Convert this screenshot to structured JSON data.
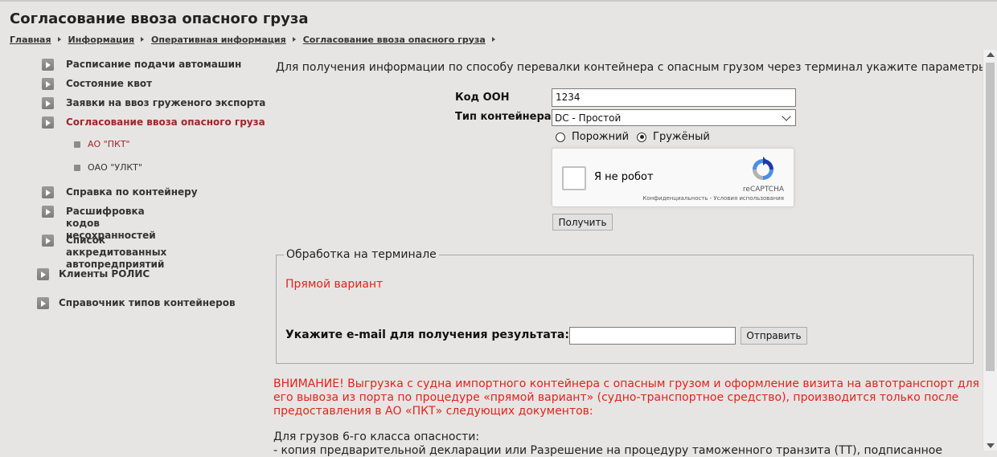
{
  "page": {
    "title": "Согласование ввоза опасного груза"
  },
  "breadcrumb": [
    "Главная",
    "Информация",
    "Оперативная информация",
    "Согласование ввоза опасного груза"
  ],
  "sidebar": {
    "items": [
      {
        "label": "Расписание подачи автомашин"
      },
      {
        "label": "Состояние квот"
      },
      {
        "label": "Заявки на ввоз груженого экспорта"
      },
      {
        "label": "Согласование ввоза опасного груза",
        "active": true
      },
      {
        "label": "Справка по контейнеру"
      },
      {
        "label": "Расшифровка кодов несохранностей"
      },
      {
        "label": "Список аккредитованных автопредприятий"
      },
      {
        "label": "Клиенты РОЛИС"
      },
      {
        "label": "Справочник типов контейнеров"
      }
    ],
    "subitems": [
      {
        "label": "АО \"ПКТ\"",
        "active": true
      },
      {
        "label": "ОАО \"УЛКТ\""
      }
    ]
  },
  "form": {
    "intro": "Для получения информации по способу перевалки контейнера с опасным грузом через терминал укажите параметры",
    "oon_label": "Код ООН",
    "oon_value": "1234",
    "container_type_label": "Тип контейнера",
    "container_type_value": "DC - Простой",
    "radio_empty": "Порожний",
    "radio_loaded": "Гружёный",
    "selected_radio": "loaded",
    "captcha_label": "Я не робот",
    "captcha_brand": "reCAPTCHA",
    "captcha_links": "Конфиденциальность - Условия использования",
    "submit_label": "Получить"
  },
  "processing": {
    "legend": "Обработка на терминале",
    "variant": "Прямой вариант",
    "email_label": "Укажите e-mail для получения результата:",
    "email_value": "",
    "send_label": "Отправить"
  },
  "notice": {
    "warning": "ВНИМАНИЕ! Выгрузка с судна импортного контейнера с опасным грузом и оформление визита на автотранспорт для его вывоза из порта по процедуре «прямой вариант» (судно-транспортное средство), производится только после предоставления в АО «ПКТ» следующих документов:",
    "class_title": "Для грузов 6-го класса опасности:",
    "class_item": "- копия предварительной декларации или Разрешение на процедуру таможенного транзита (ТТ), подписанное"
  },
  "colors": {
    "background": "#e6e5e3",
    "active_link": "#a1252b",
    "alert_red": "#e0231c"
  }
}
